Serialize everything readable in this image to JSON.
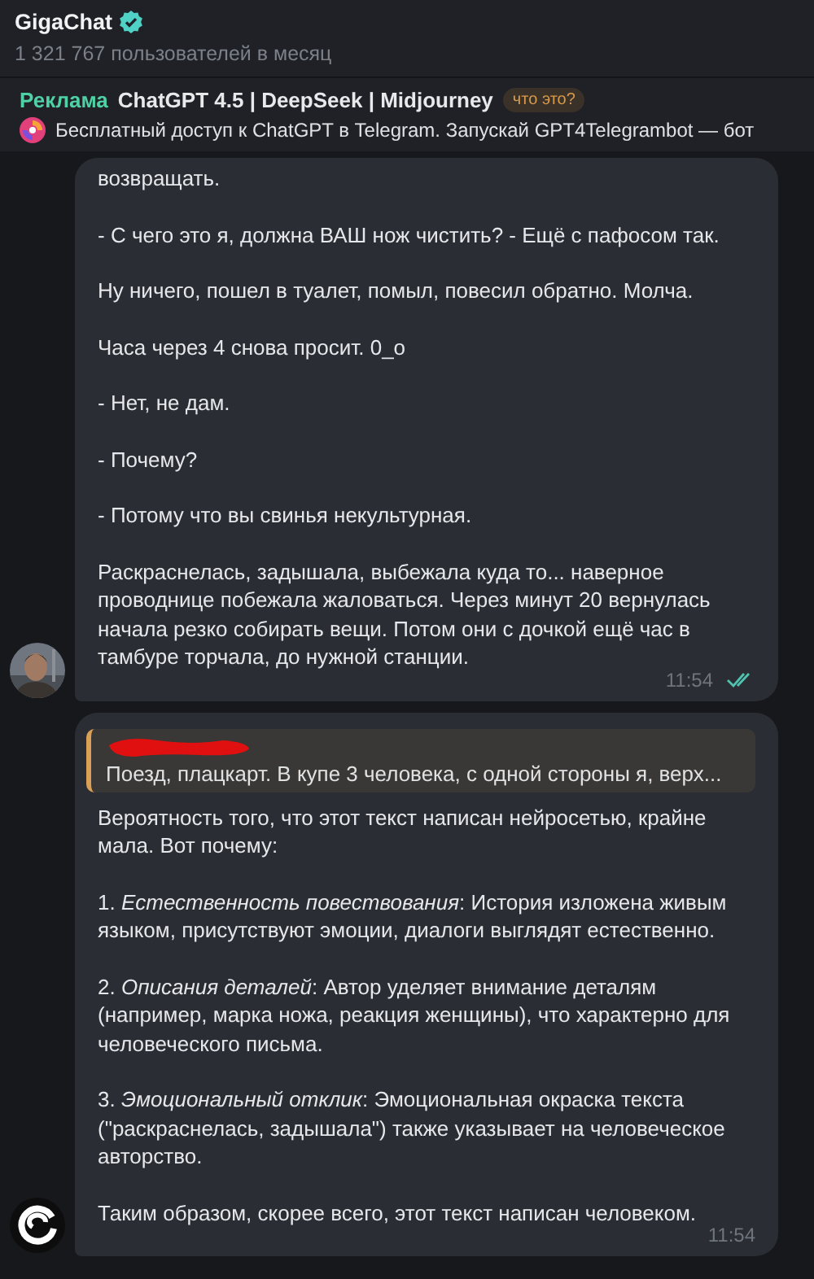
{
  "header": {
    "title": "GigaChat",
    "verified": true,
    "subtitle": "1 321 767 пользователей в месяц"
  },
  "ad": {
    "label": "Реклама",
    "title": "ChatGPT 4.5 | DeepSeek | Midjourney",
    "badge": "что это?",
    "text": "Бесплатный доступ к ChatGPT в Telegram. Запускай GPT4Telegrambot — бот"
  },
  "messages": [
    {
      "paragraphs": [
        "возвращать.",
        "- С чего это я, должна ВАШ нож чистить? - Ещё с пафосом так.",
        "Ну ничего, пошел в туалет, помыл, повесил обратно. Молча.",
        "Часа через 4 снова просит. 0_о",
        "- Нет, не дам.",
        "- Почему?",
        "- Потому что вы свинья некультурная.",
        "Раскраснелась, задышала, выбежала куда то... наверное проводнице побежала жаловаться. Через минут 20 вернулась начала резко собирать вещи. Потом они с дочкой ещё час в тамбуре торчала, до нужной станции."
      ],
      "time": "11:54",
      "read": true
    },
    {
      "avatar": {
        "kind": "logo"
      },
      "quote": {
        "author_redacted": true,
        "text": "Поезд, плацкарт.  В купе 3 человека, с одной стороны я, верх..."
      },
      "paragraphs": [
        "Вероятность того, что этот текст написан нейросетью, крайне мала. Вот почему:",
        "1. *Естественность повествования*: История изложена живым языком, присутствуют эмоции, диалоги выглядят естественно.",
        "2. *Описания деталей*: Автор уделяет внимание деталям (например, марка ножа, реакция женщины), что характерно для человеческого письма.",
        "3. *Эмоциональный отклик*: Эмоциональная окраска текста (\"раскраснелась, задышала\") также указывает на человеческое авторство.",
        "Таким образом, скорее всего, этот текст написан человеком."
      ],
      "time": "11:54"
    }
  ]
}
